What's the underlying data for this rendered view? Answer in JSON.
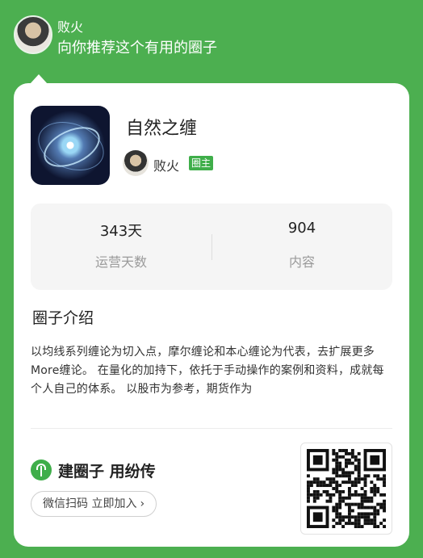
{
  "sharer": {
    "name": "败火",
    "message": "向你推荐这个有用的圈子"
  },
  "circle": {
    "title": "自然之缠",
    "owner_name": "败火",
    "owner_badge": "圈主",
    "stats": [
      {
        "value": "343天",
        "label": "运营天数"
      },
      {
        "value": "904",
        "label": "内容"
      }
    ],
    "intro_heading": "圈子介绍",
    "intro_text": "以均线系列缠论为切入点，摩尔缠论和本心缠论为代表，去扩展更多More缠论。 在量化的加持下，依托于手动操作的案例和资料，成就每个人自己的体系。 以股市为参考，期货作为"
  },
  "footer": {
    "slogan": "建圈子 用纷传",
    "join_label": "微信扫码 立即加入",
    "join_chevron": "›"
  },
  "colors": {
    "background": "#4caf50",
    "accent": "#3fae4a"
  }
}
